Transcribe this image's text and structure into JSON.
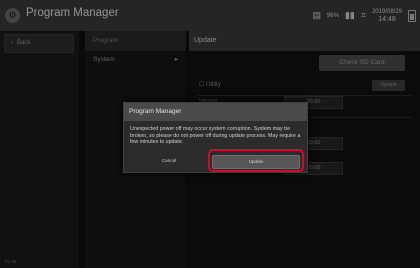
{
  "titlebar": {
    "app_title": "Program Manager",
    "status": {
      "signal_percent": "96%",
      "date": "2019/08/29",
      "time": "14:48"
    }
  },
  "leftcol": {
    "back_label": "Back",
    "version": "01.06"
  },
  "midcol": {
    "header": "Program",
    "items": [
      {
        "label": "System",
        "arrow": "▸"
      }
    ]
  },
  "rightpanel": {
    "header": "Update",
    "check_sd_label": "Check SD Card",
    "utility_label": "Utility",
    "utility_update_label": "Update",
    "rows": [
      {
        "label": "Version",
        "value": "00.00"
      },
      {
        "label": "",
        "value": "00.00"
      },
      {
        "label": "",
        "value": "00.00"
      }
    ]
  },
  "modal": {
    "title": "Program Manager",
    "message": "Unexpected power off may occur system corruption. System may be broken, so please do not power off during update process. May require a few minutes to update.",
    "cancel_label": "Cancel",
    "update_label": "Update"
  },
  "colors": {
    "highlight": "#c8102e",
    "titlebar": "#3a3a3a",
    "background": "#0e0e0e"
  },
  "icons": [
    "app-logo-icon",
    "battery-icon",
    "signal-icon",
    "sd-card-icon",
    "wifi-icon",
    "chevron-left-icon",
    "chevron-right-icon"
  ]
}
